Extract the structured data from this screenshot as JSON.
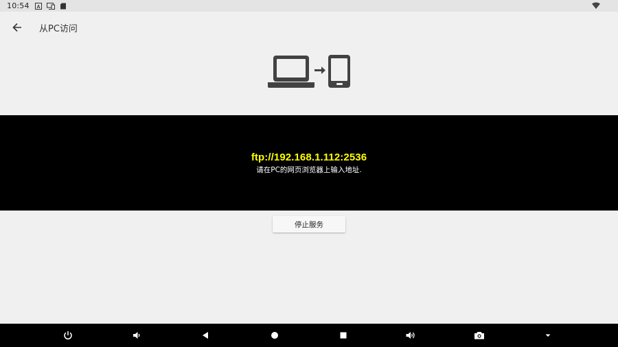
{
  "status_bar": {
    "time": "10:54",
    "icons": [
      "keyboard-a-icon",
      "screen-cast-icon",
      "sd-card-icon",
      "wifi-icon"
    ]
  },
  "app_bar": {
    "title": "从PC访问",
    "back_icon": "arrow-left-icon"
  },
  "hero": {
    "icons": [
      "laptop-icon",
      "arrow-right-icon",
      "phone-icon"
    ]
  },
  "info": {
    "address": "ftp://192.168.1.112:2536",
    "hint": "请在PC的网页浏览器上输入地址."
  },
  "actions": {
    "stop_label": "停止服务"
  },
  "nav_bar": {
    "icons": [
      "power-icon",
      "volume-down-icon",
      "back-triangle-icon",
      "home-circle-icon",
      "recents-square-icon",
      "volume-up-icon",
      "camera-icon",
      "dropdown-caret-icon"
    ]
  },
  "colors": {
    "address": "#ffff00",
    "band": "#000000",
    "background": "#f0f0f0"
  }
}
